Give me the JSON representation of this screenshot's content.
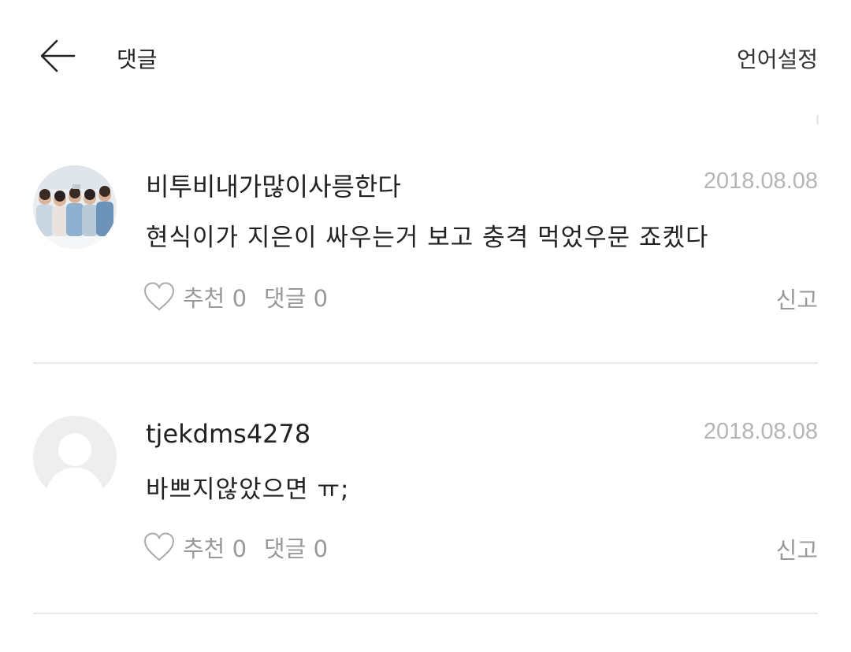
{
  "header": {
    "title": "댓글",
    "language_label": "언어설정",
    "back_icon": "arrow-left-icon"
  },
  "comments": [
    {
      "username": "비투비내가많이사릉한다",
      "date": "2018.08.08",
      "text": "현식이가 지은이 싸우는거 보고 충격 먹었우문 죠켔다",
      "like_label": "추천 0",
      "reply_label": "댓글 0",
      "report_label": "신고",
      "avatar": "group-photo-avatar"
    },
    {
      "username": "tjekdms4278",
      "date": "2018.08.08",
      "text": "바쁘지않았으면 ㅠ;",
      "like_label": "추천 0",
      "reply_label": "댓글 0",
      "report_label": "신고",
      "avatar": "default-user-avatar"
    }
  ],
  "colors": {
    "date": "#b5b5b5",
    "action_text": "#999999",
    "divider": "#e8e8e8",
    "default_avatar": "#eeeeee"
  }
}
